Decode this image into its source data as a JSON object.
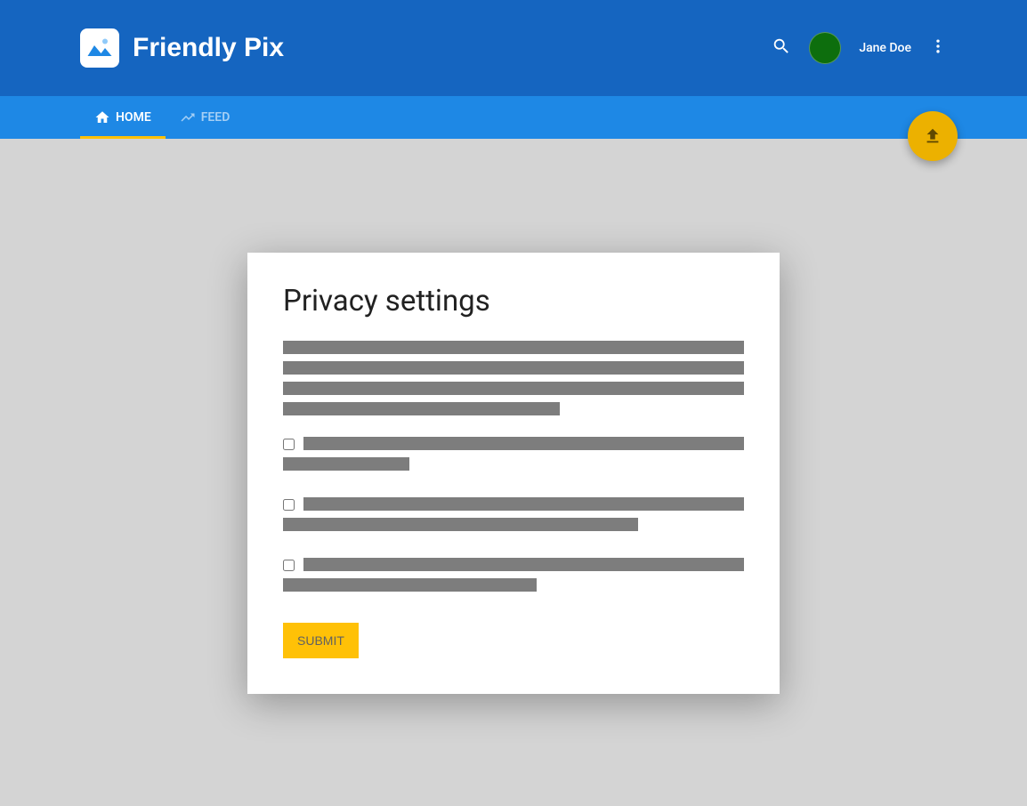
{
  "header": {
    "app_title": "Friendly Pix",
    "username": "Jane Doe"
  },
  "tabs": {
    "home_label": "HOME",
    "feed_label": "FEED"
  },
  "card": {
    "title": "Privacy settings",
    "submit_label": "SUBMIT"
  },
  "colors": {
    "header_bg": "#1565c0",
    "tabs_bg": "#1e88e5",
    "accent": "#ffc107",
    "fab_bg": "#ecb100"
  }
}
